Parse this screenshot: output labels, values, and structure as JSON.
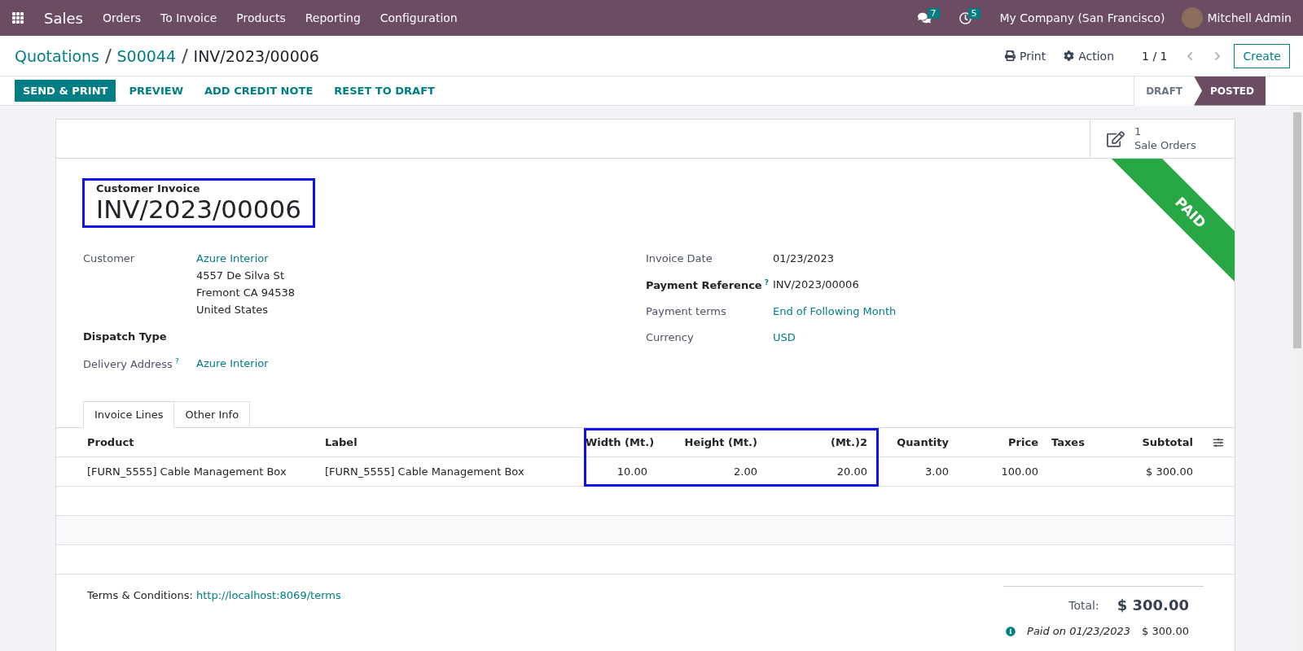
{
  "navbar": {
    "app": "Sales",
    "menus": [
      "Orders",
      "To Invoice",
      "Products",
      "Reporting",
      "Configuration"
    ],
    "messages_count": "7",
    "activities_count": "5",
    "company": "My Company (San Francisco)",
    "user": "Mitchell Admin"
  },
  "breadcrumbs": [
    "Quotations",
    "S00044",
    "INV/2023/00006"
  ],
  "control": {
    "print": "Print",
    "action": "Action",
    "pager": "1 / 1",
    "create": "Create"
  },
  "buttons": [
    {
      "label": "SEND & PRINT",
      "primary": true
    },
    {
      "label": "PREVIEW",
      "primary": false
    },
    {
      "label": "ADD CREDIT NOTE",
      "primary": false
    },
    {
      "label": "RESET TO DRAFT",
      "primary": false
    }
  ],
  "statusbar": [
    {
      "label": "DRAFT",
      "selected": false
    },
    {
      "label": "POSTED",
      "selected": true
    }
  ],
  "smart_button": {
    "count": "1",
    "label": "Sale Orders"
  },
  "ribbon": "PAID",
  "title": {
    "subtitle": "Customer Invoice",
    "name": "INV/2023/00006",
    "highlighted": true
  },
  "left_fields": [
    {
      "label": "Customer",
      "bold": false,
      "lines": [
        "Azure Interior",
        "4557 De Silva St",
        "Fremont CA 94538",
        "United States"
      ]
    },
    {
      "label": "Dispatch Type",
      "bold": true
    },
    {
      "label": "Delivery Address",
      "bold": false,
      "help": "?",
      "lines": [
        "Azure Interior"
      ]
    }
  ],
  "right_fields": [
    {
      "label": "Invoice Date",
      "bold": false,
      "link": false,
      "value": "01/23/2023"
    },
    {
      "label": "Payment Reference",
      "bold": true,
      "help": "?",
      "link": false,
      "value": "INV/2023/00006"
    },
    {
      "label": "Payment terms",
      "bold": false,
      "link": true,
      "value": "End of Following Month"
    },
    {
      "label": "Currency",
      "bold": false,
      "link": true,
      "value": "USD"
    }
  ],
  "tabs": [
    {
      "label": "Invoice Lines",
      "selected": true
    },
    {
      "label": "Other Info",
      "selected": false
    }
  ],
  "table": {
    "columns": [
      {
        "label": "Product",
        "kind": "text",
        "highlighted": false
      },
      {
        "label": "Label",
        "kind": "text",
        "highlighted": false
      },
      {
        "label": "Width (Mt.)",
        "kind": "number",
        "highlighted": true
      },
      {
        "label": "Height (Mt.)",
        "kind": "number",
        "highlighted": true
      },
      {
        "label": "(Mt.)2",
        "kind": "number",
        "highlighted": true
      },
      {
        "label": "Quantity",
        "kind": "number",
        "highlighted": false
      },
      {
        "label": "Price",
        "kind": "number",
        "highlighted": false
      },
      {
        "label": "Taxes",
        "kind": "text",
        "highlighted": false
      },
      {
        "label": "Subtotal",
        "kind": "number",
        "highlighted": false
      }
    ],
    "rows": [
      [
        "[FURN_5555] Cable Management Box",
        "[FURN_5555] Cable Management Box",
        "10.00",
        "2.00",
        "20.00",
        "3.00",
        "100.00",
        "",
        "$ 300.00"
      ]
    ]
  },
  "footer": {
    "terms_label": "Terms & Conditions:",
    "terms_link": "http://localhost:8069/terms",
    "total_label": "Total:",
    "total_value": "$ 300.00",
    "payment_label": "Paid on 01/23/2023",
    "payment_value": "$ 300.00"
  }
}
